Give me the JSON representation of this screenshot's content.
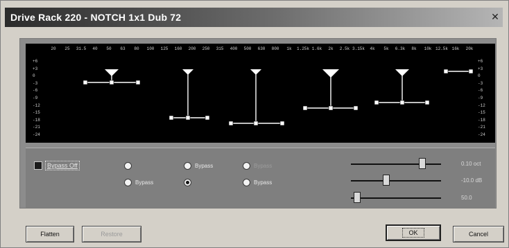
{
  "window": {
    "title": "Drive Rack 220 - NOTCH 1x1 Dub 72"
  },
  "graph": {
    "freq_labels": [
      "20",
      "25",
      "31.5",
      "40",
      "50",
      "63",
      "80",
      "100",
      "125",
      "160",
      "200",
      "250",
      "315",
      "400",
      "500",
      "630",
      "800",
      "1k",
      "1.25k",
      "1.6k",
      "2k",
      "2.5k",
      "3.15k",
      "4k",
      "5k",
      "6.3k",
      "8k",
      "10k",
      "12.5k",
      "16k",
      "20k"
    ],
    "db_labels": [
      "+6",
      "+3",
      "0",
      "-3",
      "-6",
      "-9",
      "-12",
      "-15",
      "-18",
      "-21",
      "-24"
    ]
  },
  "controls": {
    "bypass_label": "Bypass Off",
    "radios": [
      {
        "label": "",
        "selected": false,
        "enabled": true
      },
      {
        "label": "Bypass",
        "selected": false,
        "enabled": true
      },
      {
        "label": "Bypass",
        "selected": false,
        "enabled": false
      },
      {
        "label": "Bypass",
        "selected": false,
        "enabled": true
      },
      {
        "label": "",
        "selected": true,
        "enabled": true
      },
      {
        "label": "Bypass",
        "selected": false,
        "enabled": true
      }
    ],
    "sliders": [
      {
        "value_text": "0.10 oct",
        "position": 0.82
      },
      {
        "value_text": "-10.0 dB",
        "position": 0.38
      },
      {
        "value_text": "50.0",
        "position": 0.03
      }
    ]
  },
  "buttons": {
    "flatten": "Flatten",
    "restore": "Restore",
    "ok": "OK",
    "cancel": "Cancel"
  },
  "colors": {
    "graph_bg": "#000000",
    "curve": "#ffffff",
    "panel_bg": "#7f7f7f",
    "dialog_bg": "#d4d0c8"
  }
}
